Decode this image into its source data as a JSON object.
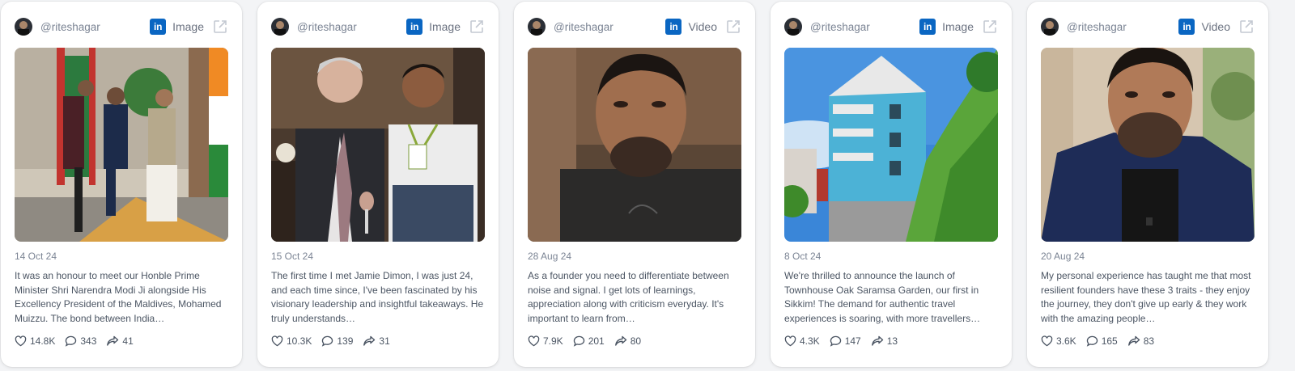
{
  "brand_color": "#0a66c2",
  "icons": {
    "network": "linkedin-icon",
    "open": "external-link-icon",
    "likes": "heart-icon",
    "comments": "comment-icon",
    "shares": "share-icon"
  },
  "posts": [
    {
      "handle": "@riteshagar",
      "network": "in",
      "type": "Image",
      "date": "14 Oct 24",
      "text": "It was an honour to meet our Honble Prime Minister Shri Narendra Modi Ji alongside His Excellency President of the Maldives, Mohamed Muizzu. The bond between India…",
      "likes": "14.8K",
      "comments": "343",
      "shares": "41"
    },
    {
      "handle": "@riteshagar",
      "network": "in",
      "type": "Image",
      "date": "15 Oct 24",
      "text": "The first time I met Jamie Dimon, I was just 24, and each time since, I've been fascinated by his visionary leadership and insightful takeaways. He truly understands…",
      "likes": "10.3K",
      "comments": "139",
      "shares": "31"
    },
    {
      "handle": "@riteshagar",
      "network": "in",
      "type": "Video",
      "date": "28 Aug 24",
      "text": "As a founder you need to differentiate between noise and signal. I get lots of learnings, appreciation along with criticism everyday.   It's important to learn from…",
      "likes": "7.9K",
      "comments": "201",
      "shares": "80"
    },
    {
      "handle": "@riteshagar",
      "network": "in",
      "type": "Image",
      "date": "8 Oct 24",
      "text": "We're thrilled to announce the launch of Townhouse Oak Saramsa Garden, our first in Sikkim!   The demand for authentic travel experiences is soaring, with more travellers…",
      "likes": "4.3K",
      "comments": "147",
      "shares": "13"
    },
    {
      "handle": "@riteshagar",
      "network": "in",
      "type": "Video",
      "date": "20 Aug 24",
      "text": "My personal experience has taught me that most resilient founders have these 3 traits - they enjoy the journey, they don't give up early & they work with the amazing people…",
      "likes": "3.6K",
      "comments": "165",
      "shares": "83"
    }
  ]
}
